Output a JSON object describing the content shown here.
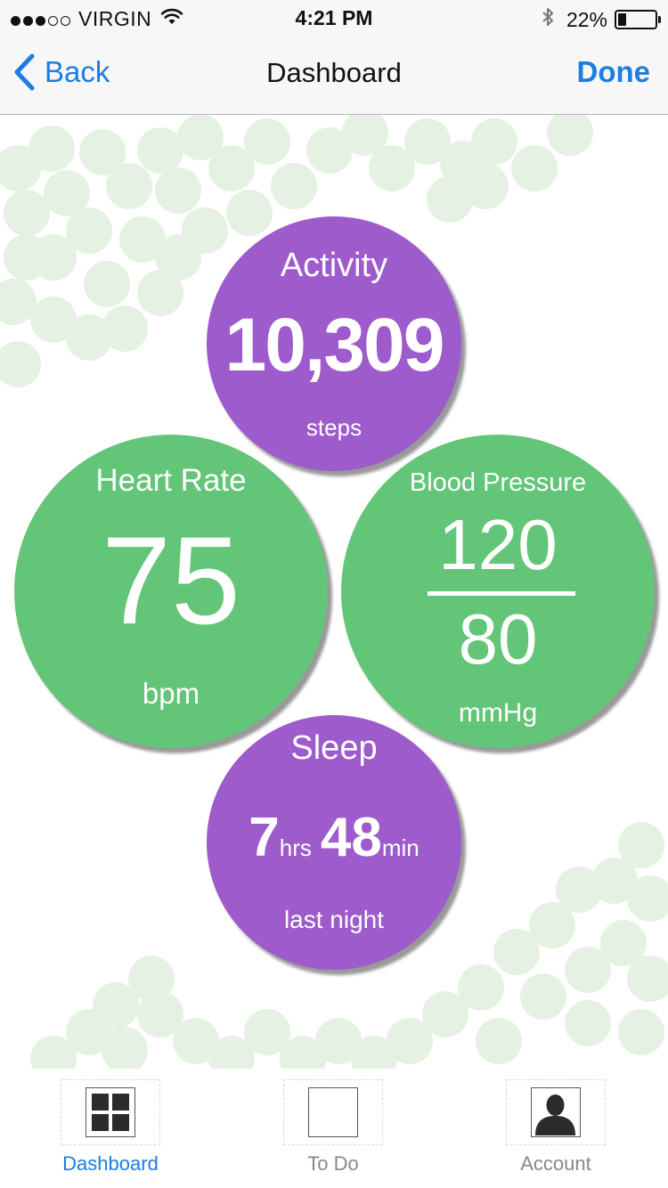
{
  "status_bar": {
    "carrier": "VIRGIN",
    "signal_bars": 3,
    "signal_max": 5,
    "time": "4:21 PM",
    "battery_percent": "22%",
    "battery_level": 0.22
  },
  "nav": {
    "back_label": "Back",
    "title": "Dashboard",
    "done_label": "Done"
  },
  "cards": {
    "activity": {
      "title": "Activity",
      "value": "10,309",
      "unit": "steps"
    },
    "heart_rate": {
      "title": "Heart Rate",
      "value": "75",
      "unit": "bpm"
    },
    "blood_pressure": {
      "title": "Blood Pressure",
      "systolic": "120",
      "diastolic": "80",
      "unit": "mmHg"
    },
    "sleep": {
      "title": "Sleep",
      "hours": "7",
      "hours_unit": "hrs",
      "minutes": "48",
      "minutes_unit": "min",
      "caption": "last night"
    }
  },
  "colors": {
    "accent": "#1d7de3",
    "purple": "#9d5bcb",
    "green": "#63c577",
    "decoration": "#e5f1e2"
  },
  "tabs": [
    {
      "label": "Dashboard",
      "icon": "dashboard-grid-icon",
      "active": true
    },
    {
      "label": "To Do",
      "icon": "todo-box-icon",
      "active": false
    },
    {
      "label": "Account",
      "icon": "account-person-icon",
      "active": false
    }
  ]
}
